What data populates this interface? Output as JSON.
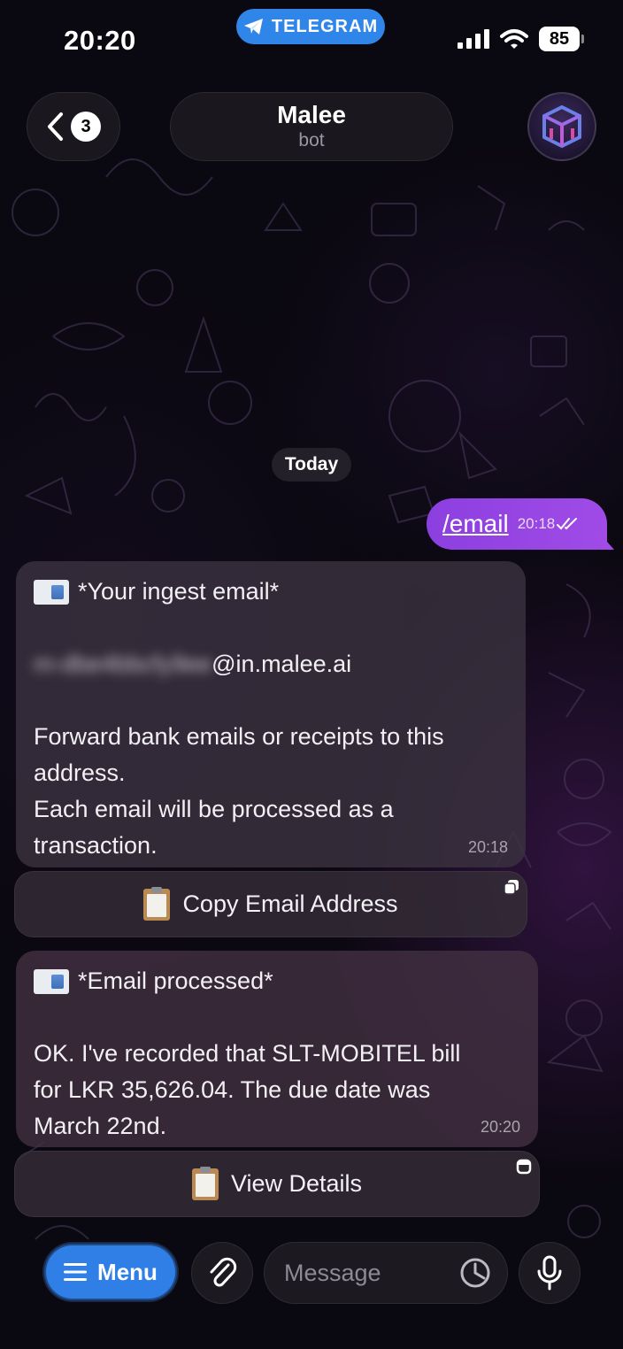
{
  "status_bar": {
    "time": "20:20",
    "app_pill": "TELEGRAM",
    "battery": "85"
  },
  "header": {
    "back_count": "3",
    "title": "Malee",
    "subtitle": "bot"
  },
  "chat": {
    "date_chip": "Today",
    "outgoing": {
      "text": "/email",
      "time": "20:18"
    },
    "message_1": {
      "heading": "*Your ingest email*",
      "email_local_blurred": "m-dbe4bbcfy9ee",
      "email_domain": "@in.malee.ai",
      "body_line_1": "Forward bank emails or receipts to this",
      "body_line_2": "address.",
      "body_line_3": "Each email will be processed as a",
      "body_line_4": "transaction.",
      "time": "20:18"
    },
    "button_1": "Copy Email Address",
    "message_2": {
      "heading": "*Email processed*",
      "body_line_1": "OK. I've recorded that SLT-MOBITEL bill",
      "body_line_2": "for LKR 35,626.04. The due date was",
      "body_line_3": "March 22nd.",
      "time": "20:20"
    },
    "button_2": "View Details"
  },
  "composer": {
    "menu_label": "Menu",
    "placeholder": "Message"
  },
  "colors": {
    "accent_blue": "#2f7fe6",
    "outgoing_bubble": "#9a48e4",
    "telegram_pill": "#2f86e8"
  }
}
